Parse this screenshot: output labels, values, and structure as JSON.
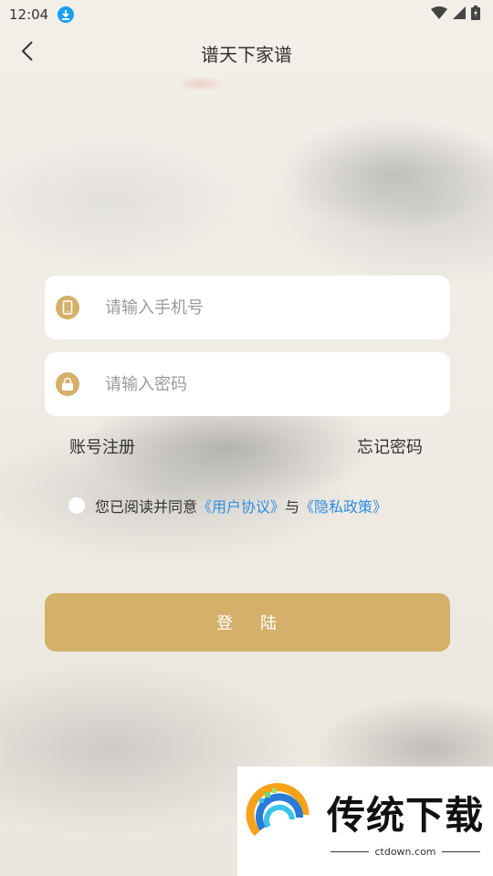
{
  "status": {
    "time": "12:04"
  },
  "header": {
    "title": "谱天下家谱"
  },
  "form": {
    "phone_placeholder": "请输入手机号",
    "password_placeholder": "请输入密码"
  },
  "links": {
    "register": "账号注册",
    "forgot": "忘记密码"
  },
  "agreement": {
    "prefix": "您已阅读并同意",
    "user_agreement": "《用户协议》",
    "and": "与",
    "privacy_policy": "《隐私政策》"
  },
  "login": {
    "char1": "登",
    "char2": "陆"
  },
  "watermark": {
    "name": "传统下载",
    "url": "ctdown.com"
  },
  "colors": {
    "accent": "#d4b06a",
    "link": "#2f8ee0"
  }
}
